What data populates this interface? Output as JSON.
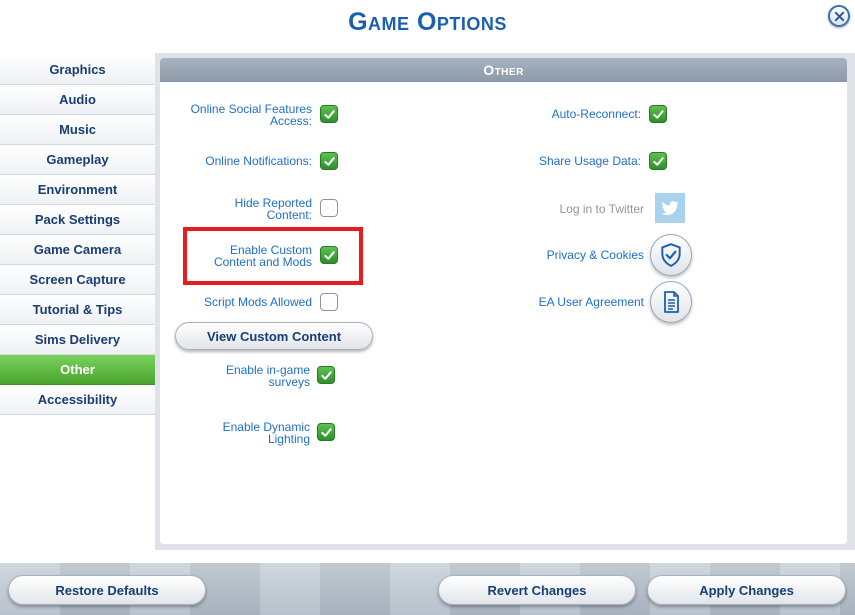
{
  "title": "Game Options",
  "close_icon": "close-icon",
  "sidebar": {
    "items": [
      {
        "label": "Graphics",
        "active": false
      },
      {
        "label": "Audio",
        "active": false
      },
      {
        "label": "Music",
        "active": false
      },
      {
        "label": "Gameplay",
        "active": false
      },
      {
        "label": "Environment",
        "active": false
      },
      {
        "label": "Pack Settings",
        "active": false
      },
      {
        "label": "Game Camera",
        "active": false
      },
      {
        "label": "Screen Capture",
        "active": false
      },
      {
        "label": "Tutorial & Tips",
        "active": false
      },
      {
        "label": "Sims Delivery",
        "active": false
      },
      {
        "label": "Other",
        "active": true
      },
      {
        "label": "Accessibility",
        "active": false
      }
    ]
  },
  "panel": {
    "header": "Other",
    "left_options": [
      {
        "label": "Online Social Features Access:",
        "checked": true
      },
      {
        "label": "Online Notifications:",
        "checked": true
      },
      {
        "label": "Hide Reported Content:",
        "checked": false
      },
      {
        "label": "Enable Custom Content and Mods",
        "checked": true
      },
      {
        "label": "Script Mods Allowed",
        "checked": false
      },
      {
        "label": "Enable in-game surveys",
        "checked": true
      },
      {
        "label": "Enable Dynamic Lighting",
        "checked": true
      }
    ],
    "view_custom_content": "View Custom Content",
    "right_options": [
      {
        "label": "Auto-Reconnect:",
        "checked": true
      },
      {
        "label": "Share Usage Data:",
        "checked": true
      }
    ],
    "twitter": {
      "label": "Log in to Twitter",
      "icon": "twitter-icon"
    },
    "privacy": {
      "label": "Privacy & Cookies",
      "icon": "shield-check-icon"
    },
    "agreement": {
      "label": "EA User Agreement",
      "icon": "document-icon"
    }
  },
  "footer": {
    "restore": "Restore Defaults",
    "revert": "Revert Changes",
    "apply": "Apply Changes"
  },
  "colors": {
    "accent_blue": "#1b5fb3",
    "link_blue": "#1f6fc8",
    "active_green": "#5cb83e",
    "check_green": "#3ba334",
    "highlight_red": "#e81c1c"
  }
}
